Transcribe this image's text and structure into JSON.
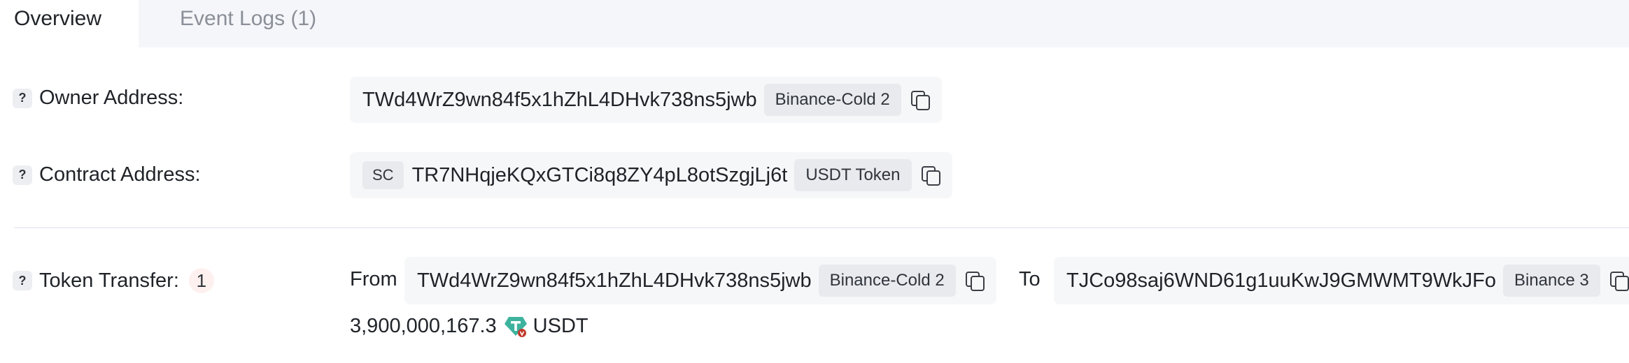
{
  "tabs": [
    {
      "label": "Overview",
      "active": true
    },
    {
      "label": "Event Logs (1)",
      "active": false
    }
  ],
  "owner": {
    "label": "Owner Address:",
    "address": "TWd4WrZ9wn84f5x1hZhL4DHvk738ns5jwb",
    "tag": "Binance-Cold 2"
  },
  "contract": {
    "label": "Contract Address:",
    "prefix": "SC",
    "address": "TR7NHqjeKQxGTCi8q8ZY4pL8otSzgjLj6t",
    "tag": "USDT Token"
  },
  "transfer": {
    "label": "Token Transfer:",
    "count": "1",
    "from_label": "From",
    "from_address": "TWd4WrZ9wn84f5x1hZhL4DHvk738ns5jwb",
    "from_tag": "Binance-Cold 2",
    "to_label": "To",
    "to_address": "TJCo98saj6WND61g1uuKwJ9GMWMT9WkJFo",
    "to_tag": "Binance 3",
    "amount": "3,900,000,167.3",
    "token_symbol": "USDT",
    "token_icon": "tether-icon",
    "token_color": "#3db39e"
  },
  "help_glyph": "?"
}
